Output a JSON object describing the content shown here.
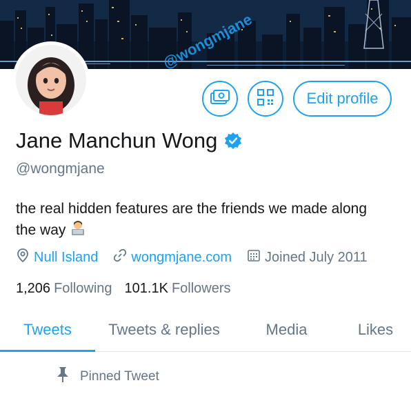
{
  "profile": {
    "name": "Jane Manchun Wong",
    "handle": "@wongmjane",
    "bio": "the real hidden features are the friends we made along the way",
    "location": "Null Island",
    "website": "wongmjane.com",
    "joined": "Joined July 2011"
  },
  "watermark": "@wongmjane",
  "actions": {
    "edit_label": "Edit profile",
    "camera_icon": "money-camera-icon",
    "qr_icon": "qr-code-icon"
  },
  "stats": {
    "following_count": "1,206",
    "following_label": "Following",
    "followers_count": "101.1K",
    "followers_label": "Followers"
  },
  "tabs": [
    {
      "label": "Tweets",
      "active": true
    },
    {
      "label": "Tweets & replies",
      "active": false
    },
    {
      "label": "Media",
      "active": false
    },
    {
      "label": "Likes",
      "active": false
    }
  ],
  "pinned": {
    "label": "Pinned Tweet"
  },
  "colors": {
    "accent": "#1da1f2",
    "secondary_text": "#657786",
    "primary_text": "#14171a"
  }
}
